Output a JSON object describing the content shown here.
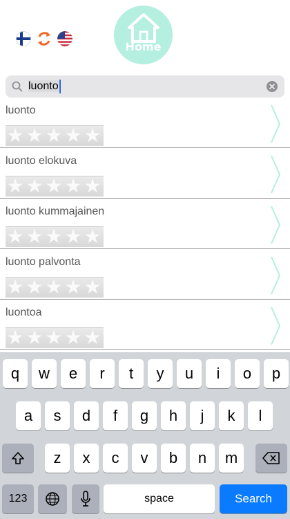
{
  "header": {
    "home_label": "Home",
    "lang_from_icon": "finland-flag-icon",
    "swap_icon": "swap-languages-icon",
    "lang_to_icon": "usa-flag-icon",
    "accent_color": "#b4efe0"
  },
  "search": {
    "value": "luonto"
  },
  "results": [
    {
      "label": "luonto",
      "rating": 0
    },
    {
      "label": "luonto elokuva",
      "rating": 0
    },
    {
      "label": "luonto kummajainen",
      "rating": 0
    },
    {
      "label": "luonto palvonta",
      "rating": 0
    },
    {
      "label": "luontoa",
      "rating": 0
    }
  ],
  "keyboard": {
    "row1": [
      "q",
      "w",
      "e",
      "r",
      "t",
      "y",
      "u",
      "i",
      "o",
      "p"
    ],
    "row2": [
      "a",
      "s",
      "d",
      "f",
      "g",
      "h",
      "j",
      "k",
      "l"
    ],
    "row3": [
      "z",
      "x",
      "c",
      "v",
      "b",
      "n",
      "m"
    ],
    "numbers_label": "123",
    "space_label": "space",
    "search_label": "Search",
    "search_color": "#0a7aff"
  }
}
